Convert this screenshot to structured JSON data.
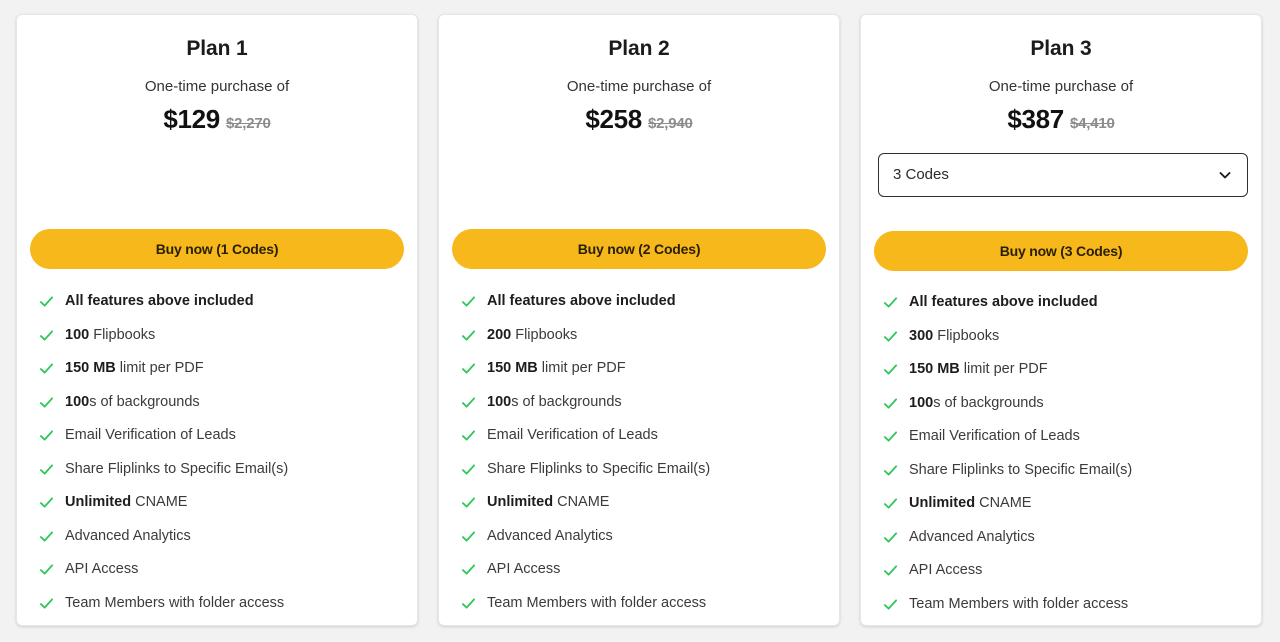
{
  "theme": {
    "page_background": "#f2f2f2",
    "card_background": "#ffffff",
    "accent_yellow": "#f6b81a",
    "check_green": "#2ec75a",
    "price_old_gray": "#8c8c8c"
  },
  "plans": [
    {
      "title": "Plan 1",
      "subtitle": "One-time purchase of",
      "price_current": "$129",
      "price_old": "$2,270",
      "has_code_select": false,
      "buy_label": "Buy now (1 Codes)",
      "features": [
        {
          "bold_prefix": "",
          "text": "All features above included",
          "all_bold": true
        },
        {
          "bold_prefix": "100",
          "text": " Flipbooks",
          "all_bold": false
        },
        {
          "bold_prefix": "150 MB",
          "text": " limit per PDF",
          "all_bold": false
        },
        {
          "bold_prefix": "100",
          "text": "s of backgrounds",
          "all_bold": false
        },
        {
          "bold_prefix": "",
          "text": "Email Verification of Leads",
          "all_bold": false
        },
        {
          "bold_prefix": "",
          "text": "Share Fliplinks to Specific Email(s)",
          "all_bold": false
        },
        {
          "bold_prefix": "Unlimited",
          "text": " CNAME",
          "all_bold": false
        },
        {
          "bold_prefix": "",
          "text": "Advanced Analytics",
          "all_bold": false
        },
        {
          "bold_prefix": "",
          "text": "API Access",
          "all_bold": false
        },
        {
          "bold_prefix": "",
          "text": "Team Members with folder access",
          "all_bold": false
        }
      ]
    },
    {
      "title": "Plan 2",
      "subtitle": "One-time purchase of",
      "price_current": "$258",
      "price_old": "$2,940",
      "has_code_select": false,
      "buy_label": "Buy now (2 Codes)",
      "features": [
        {
          "bold_prefix": "",
          "text": "All features above included",
          "all_bold": true
        },
        {
          "bold_prefix": "200",
          "text": " Flipbooks",
          "all_bold": false
        },
        {
          "bold_prefix": "150 MB",
          "text": " limit per PDF",
          "all_bold": false
        },
        {
          "bold_prefix": "100",
          "text": "s of backgrounds",
          "all_bold": false
        },
        {
          "bold_prefix": "",
          "text": "Email Verification of Leads",
          "all_bold": false
        },
        {
          "bold_prefix": "",
          "text": "Share Fliplinks to Specific Email(s)",
          "all_bold": false
        },
        {
          "bold_prefix": "Unlimited",
          "text": " CNAME",
          "all_bold": false
        },
        {
          "bold_prefix": "",
          "text": "Advanced Analytics",
          "all_bold": false
        },
        {
          "bold_prefix": "",
          "text": "API Access",
          "all_bold": false
        },
        {
          "bold_prefix": "",
          "text": "Team Members with folder access",
          "all_bold": false
        }
      ]
    },
    {
      "title": "Plan 3",
      "subtitle": "One-time purchase of",
      "price_current": "$387",
      "price_old": "$4,410",
      "has_code_select": true,
      "code_select_value": "3 Codes",
      "buy_label": "Buy now (3 Codes)",
      "features": [
        {
          "bold_prefix": "",
          "text": "All features above included",
          "all_bold": true
        },
        {
          "bold_prefix": "300",
          "text": " Flipbooks",
          "all_bold": false
        },
        {
          "bold_prefix": "150 MB",
          "text": " limit per PDF",
          "all_bold": false
        },
        {
          "bold_prefix": "100",
          "text": "s of backgrounds",
          "all_bold": false
        },
        {
          "bold_prefix": "",
          "text": "Email Verification of Leads",
          "all_bold": false
        },
        {
          "bold_prefix": "",
          "text": "Share Fliplinks to Specific Email(s)",
          "all_bold": false
        },
        {
          "bold_prefix": "Unlimited",
          "text": " CNAME",
          "all_bold": false
        },
        {
          "bold_prefix": "",
          "text": "Advanced Analytics",
          "all_bold": false
        },
        {
          "bold_prefix": "",
          "text": "API Access",
          "all_bold": false
        },
        {
          "bold_prefix": "",
          "text": "Team Members with folder access",
          "all_bold": false
        }
      ]
    }
  ]
}
